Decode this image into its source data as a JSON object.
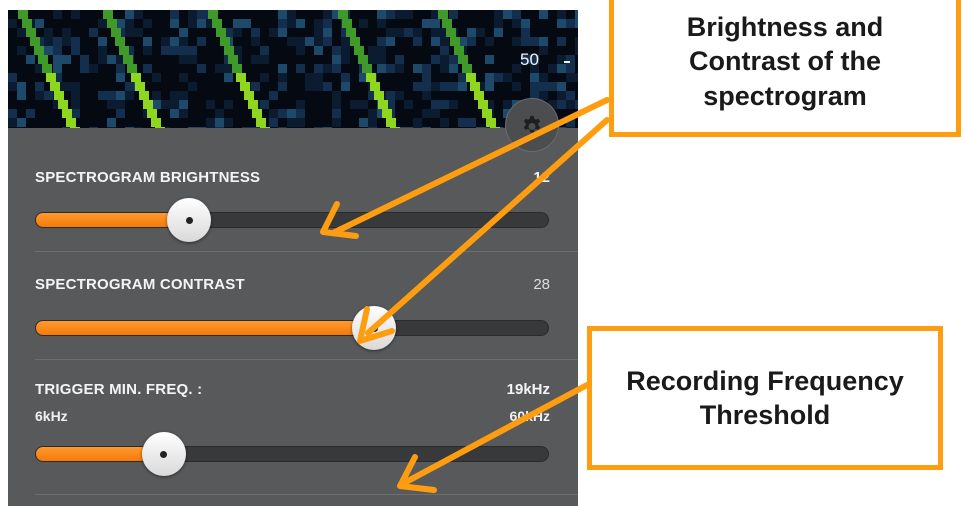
{
  "spectrogram": {
    "axis_value": "50"
  },
  "settings": {
    "brightness": {
      "label": "SPECTROGRAM BRIGHTNESS",
      "value": "12",
      "fraction": 0.3
    },
    "contrast": {
      "label": "SPECTROGRAM CONTRAST",
      "value": "28",
      "fraction": 0.66
    },
    "trigger": {
      "label": "TRIGGER MIN. FREQ. :",
      "value": "19kHz",
      "min": "6kHz",
      "max": "60kHz",
      "fraction": 0.25
    }
  },
  "callouts": {
    "top": "Brightness and Contrast of the spectrogram",
    "bottom": "Recording Frequency Threshold"
  },
  "colors": {
    "accent": "#ff9d10",
    "slider_fill": "#f57a0a"
  }
}
